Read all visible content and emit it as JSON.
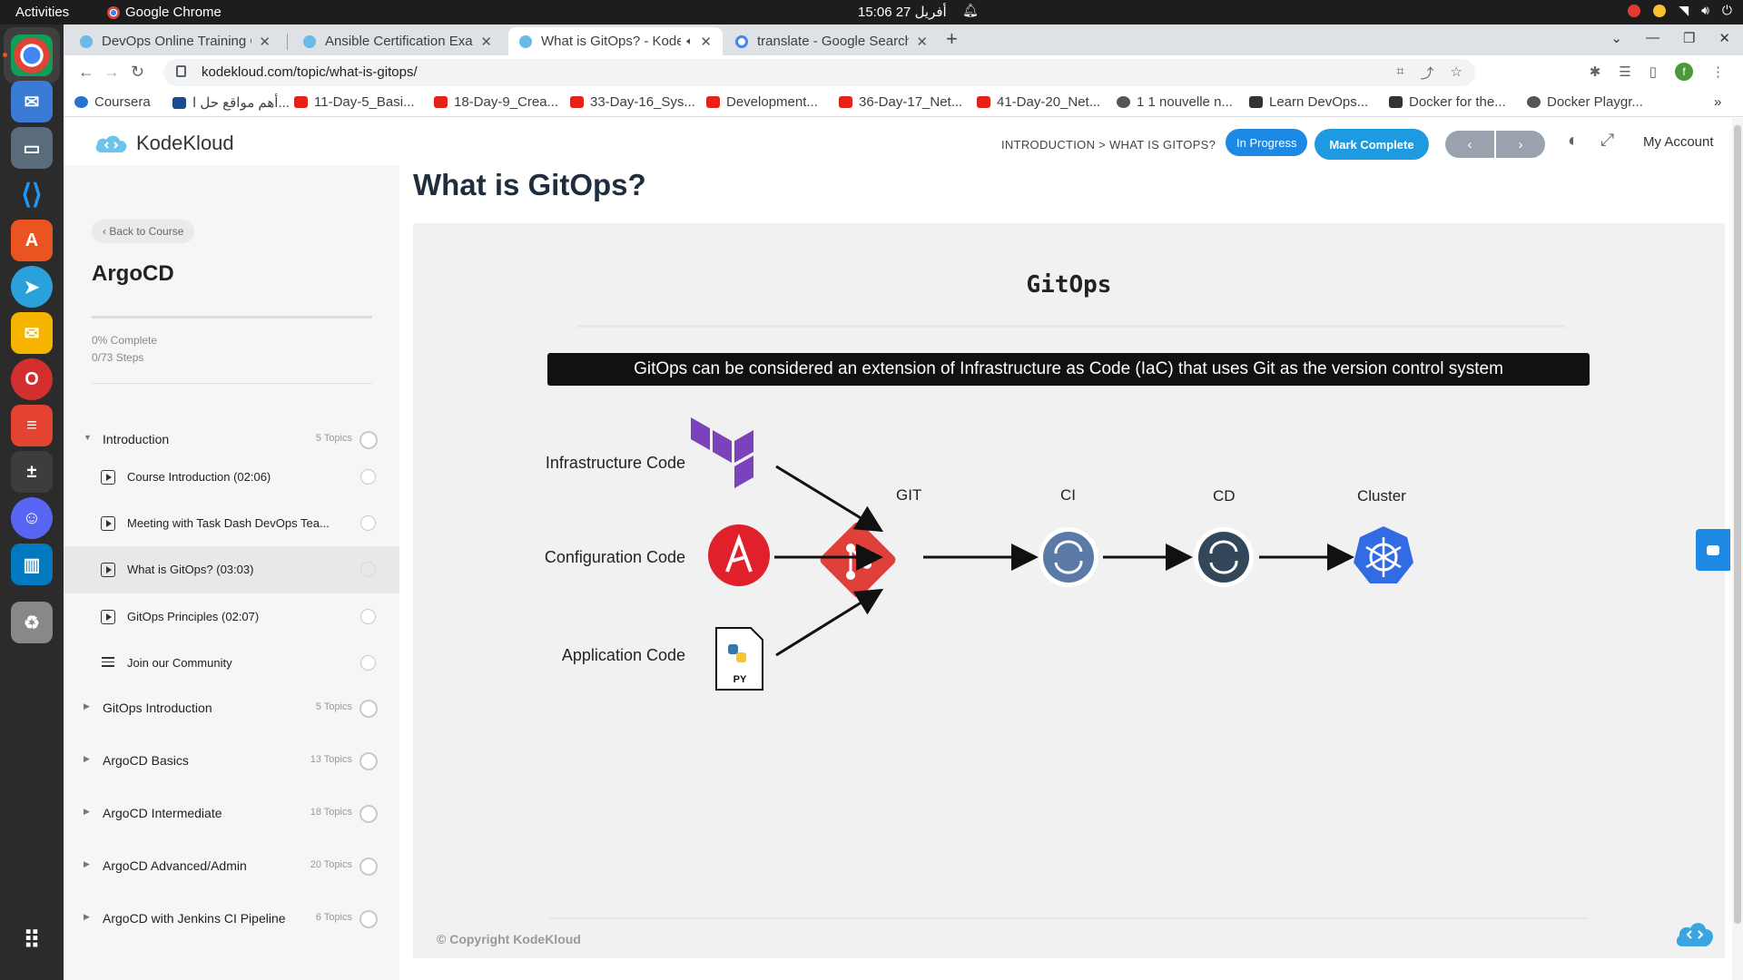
{
  "os": {
    "activities": "Activities",
    "app_name": "Google Chrome",
    "clock": "15:06  27 أفريل"
  },
  "browser": {
    "tabs": [
      {
        "label": "DevOps Online Training C",
        "active": false
      },
      {
        "label": "Ansible Certification Exan",
        "active": false
      },
      {
        "label": "What is GitOps? - Kode",
        "active": true
      },
      {
        "label": "translate - Google Search",
        "active": false
      }
    ],
    "url": "kodekloud.com/topic/what-is-gitops/",
    "bookmarks": [
      "Coursera",
      "أهم مواقع حل ا...",
      "11-Day-5_Basi...",
      "18-Day-9_Crea...",
      "33-Day-16_Sys...",
      "Development...",
      "36-Day-17_Net...",
      "41-Day-20_Net...",
      "1 1 nouvelle n...",
      "Learn DevOps...",
      "Docker for the...",
      "Docker Playgr..."
    ],
    "profile_initial": "f"
  },
  "header": {
    "logo": "KodeKloud",
    "breadcrumb": "INTRODUCTION > WHAT IS GITOPS?",
    "status_button": "In Progress",
    "complete_button": "Mark Complete",
    "prev": "‹",
    "next": "›",
    "account": "My Account"
  },
  "sidebar": {
    "back": "‹ Back to Course",
    "course_title": "ArgoCD",
    "progress_fraction": 0,
    "progress_text": "0% Complete",
    "steps_text": "0/73 Steps",
    "sections": [
      {
        "title": "Introduction",
        "count": "5 Topics",
        "expanded": true
      },
      {
        "title": "GitOps Introduction",
        "count": "5 Topics"
      },
      {
        "title": "ArgoCD Basics",
        "count": "13 Topics"
      },
      {
        "title": "ArgoCD Intermediate",
        "count": "18 Topics"
      },
      {
        "title": "ArgoCD Advanced/Admin",
        "count": "20 Topics"
      },
      {
        "title": "ArgoCD with Jenkins CI Pipeline",
        "count": "6 Topics"
      }
    ],
    "lessons": [
      {
        "title": "Course Introduction (02:06)",
        "type": "video"
      },
      {
        "title": "Meeting with Task Dash DevOps Tea...",
        "type": "video"
      },
      {
        "title": "What is GitOps? (03:03)",
        "type": "video",
        "active": true
      },
      {
        "title": "GitOps Principles (02:07)",
        "type": "video"
      },
      {
        "title": "Join our Community",
        "type": "text"
      }
    ]
  },
  "main": {
    "lesson_title": "What is GitOps?",
    "slide": {
      "title": "GitOps",
      "banner": "GitOps can be considered an extension of Infrastructure as Code (IaC) that uses Git as the version control system",
      "inputs": [
        "Infrastructure Code",
        "Configuration Code",
        "Application Code"
      ],
      "nodes": [
        "GIT",
        "CI",
        "CD",
        "Cluster"
      ],
      "py_label": "PY",
      "copyright": "© Copyright KodeKloud"
    }
  },
  "colors": {
    "accent": "#1e88e5",
    "git": "#e0403a",
    "ansible": "#e0212b",
    "terraform": "#7b42bc",
    "kubernetes": "#326ce5"
  }
}
